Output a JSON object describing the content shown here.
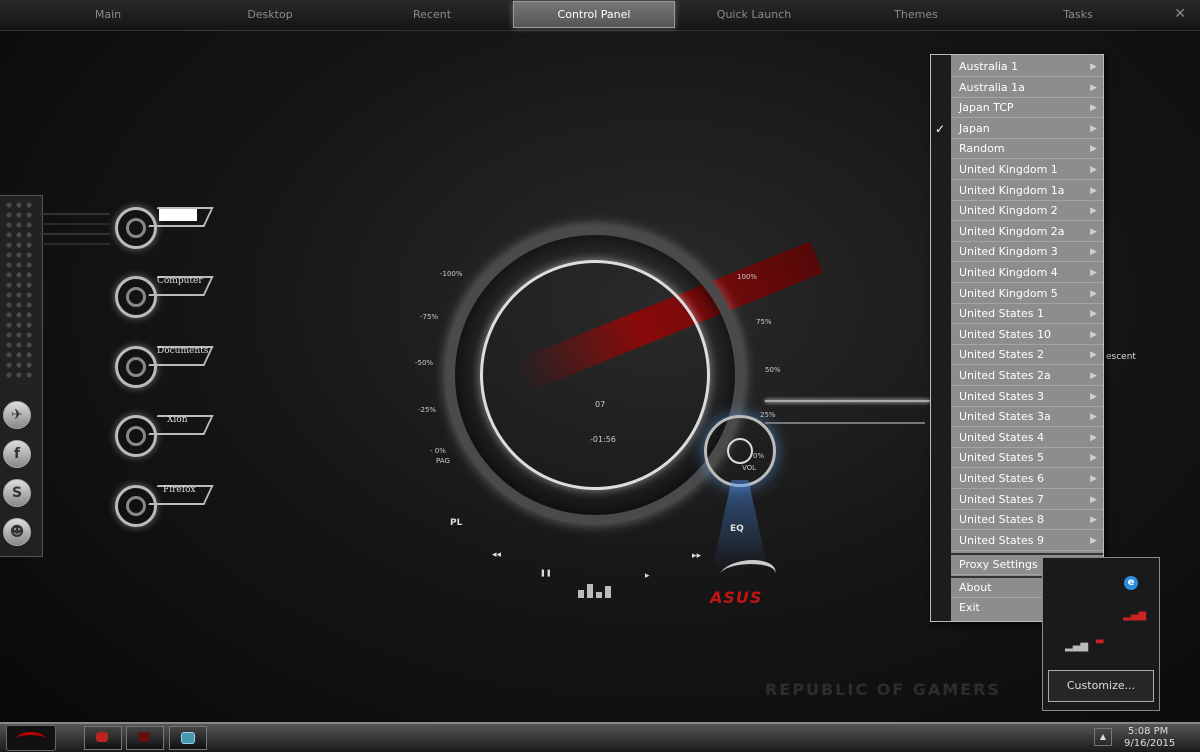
{
  "topbar": {
    "tabs": [
      "Main",
      "Desktop",
      "Recent",
      "Control Panel",
      "Quick Launch",
      "Themes",
      "Tasks"
    ],
    "active_tab": "Control Panel",
    "close_icon": "close-icon"
  },
  "shortcuts": [
    "",
    "Computer",
    "Documents",
    "Xion",
    "Firefox"
  ],
  "social_icons": [
    "twitter-icon",
    "facebook-icon",
    "skype-icon",
    "people-icon"
  ],
  "gauge": {
    "left_ticks": [
      "-100%",
      "-75%",
      "-50%",
      "-25%",
      "- 0%"
    ],
    "right_ticks": [
      "100%",
      "75%",
      "50%",
      "25%"
    ],
    "pag_label": "PAG",
    "track_number": "07",
    "time": "-01:56",
    "knob_label": "VOL",
    "knob_value": "0%"
  },
  "player": {
    "pl_label": "PL",
    "eq_label": "EQ",
    "prev_icon": "rewind-icon",
    "play_icon": "play-icon",
    "next_icon": "fast-forward-icon",
    "pause_icon": "pause-icon"
  },
  "brand": {
    "asus": "ASUS",
    "rog": "REPUBLIC OF GAMERS",
    "accent": "#c21414"
  },
  "side_text": "escent",
  "menu": {
    "items": [
      {
        "label": "Australia 1",
        "submenu": true,
        "checked": false
      },
      {
        "label": "Australia 1a",
        "submenu": true,
        "checked": false
      },
      {
        "label": "Japan TCP",
        "submenu": true,
        "checked": false
      },
      {
        "label": "Japan",
        "submenu": true,
        "checked": true
      },
      {
        "label": "Random",
        "submenu": true,
        "checked": false
      },
      {
        "label": "United Kingdom 1",
        "submenu": true,
        "checked": false
      },
      {
        "label": "United Kingdom 1a",
        "submenu": true,
        "checked": false
      },
      {
        "label": "United Kingdom 2",
        "submenu": true,
        "checked": false
      },
      {
        "label": "United Kingdom 2a",
        "submenu": true,
        "checked": false
      },
      {
        "label": "United Kingdom 3",
        "submenu": true,
        "checked": false
      },
      {
        "label": "United Kingdom 4",
        "submenu": true,
        "checked": false
      },
      {
        "label": "United Kingdom 5",
        "submenu": true,
        "checked": false
      },
      {
        "label": "United States 1",
        "submenu": true,
        "checked": false
      },
      {
        "label": "United States 10",
        "submenu": true,
        "checked": false
      },
      {
        "label": "United States 2",
        "submenu": true,
        "checked": false
      },
      {
        "label": "United States 2a",
        "submenu": true,
        "checked": false
      },
      {
        "label": "United States 3",
        "submenu": true,
        "checked": false
      },
      {
        "label": "United States 3a",
        "submenu": true,
        "checked": false
      },
      {
        "label": "United States 4",
        "submenu": true,
        "checked": false
      },
      {
        "label": "United States 5",
        "submenu": true,
        "checked": false
      },
      {
        "label": "United States 6",
        "submenu": true,
        "checked": false
      },
      {
        "label": "United States 7",
        "submenu": true,
        "checked": false
      },
      {
        "label": "United States 8",
        "submenu": true,
        "checked": false
      },
      {
        "label": "United States 9",
        "submenu": true,
        "checked": false
      }
    ],
    "proxy": "Proxy Settings",
    "about": "About",
    "exit": "Exit"
  },
  "tray_popup": {
    "customize": "Customize...",
    "icons": [
      "eset-icon",
      "signal-bars-icon",
      "battery-icon",
      "network-icon"
    ]
  },
  "taskbar": {
    "time": "5:08 PM",
    "date": "9/16/2015",
    "buttons": [
      "start-button",
      "app-button-1",
      "app-button-2",
      "keyboard-button"
    ]
  }
}
